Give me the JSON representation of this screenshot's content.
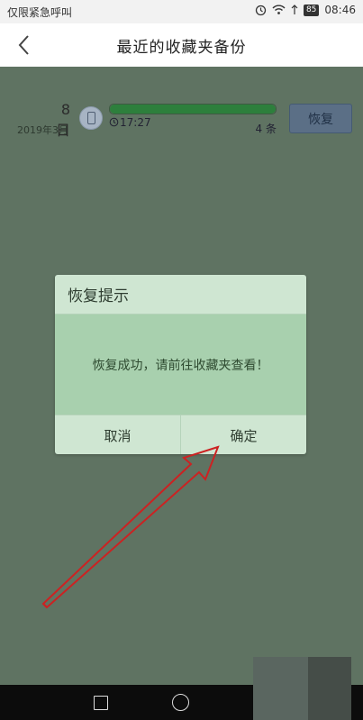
{
  "status_bar": {
    "carrier": "仅限紧急呼叫",
    "battery": "85",
    "time": "08:46"
  },
  "header": {
    "title": "最近的收藏夹备份",
    "back_icon": "chevron-left-icon"
  },
  "backup_item": {
    "day": "8日",
    "month": "2019年3月",
    "device_icon": "phone-icon",
    "progress": 1.0,
    "time": "17:27",
    "count": "4 条",
    "restore_label": "恢复"
  },
  "dialog": {
    "title": "恢复提示",
    "message": "恢复成功，请前往收藏夹查看！",
    "cancel_label": "取消",
    "confirm_label": "确定"
  },
  "colors": {
    "overlay_bg": "#5f7362",
    "dialog_header": "#cfe6d2",
    "dialog_body": "#a8d0ae",
    "progress": "#2d7f3c",
    "arrow": "#cc2222"
  }
}
